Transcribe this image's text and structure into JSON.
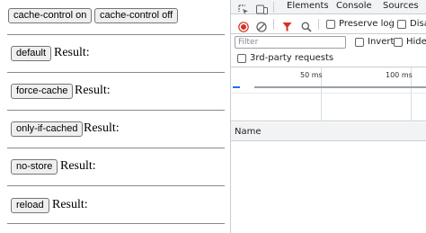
{
  "page": {
    "top_buttons": [
      {
        "label": "cache-control on"
      },
      {
        "label": "cache-control off"
      }
    ],
    "result_label": "Result:",
    "modes": [
      {
        "label": "default"
      },
      {
        "label": "force-cache"
      },
      {
        "label": "only-if-cached"
      },
      {
        "label": "no-store"
      },
      {
        "label": "reload"
      }
    ]
  },
  "devtools": {
    "tabs": [
      {
        "label": "Elements"
      },
      {
        "label": "Console"
      },
      {
        "label": "Sources"
      }
    ],
    "toolbar": {
      "preserve_log": "Preserve log",
      "disable_cache": "Disa"
    },
    "filter": {
      "placeholder": "Filter",
      "invert": "Invert",
      "hide": "Hide"
    },
    "third_party": "3rd-party requests",
    "timeline": {
      "ticks": [
        "50 ms",
        "100 ms"
      ]
    },
    "table": {
      "name_header": "Name"
    },
    "colors": {
      "record": "#d93025",
      "filter_active": "#d93025",
      "tab_bg": "#f1f3f4"
    }
  }
}
